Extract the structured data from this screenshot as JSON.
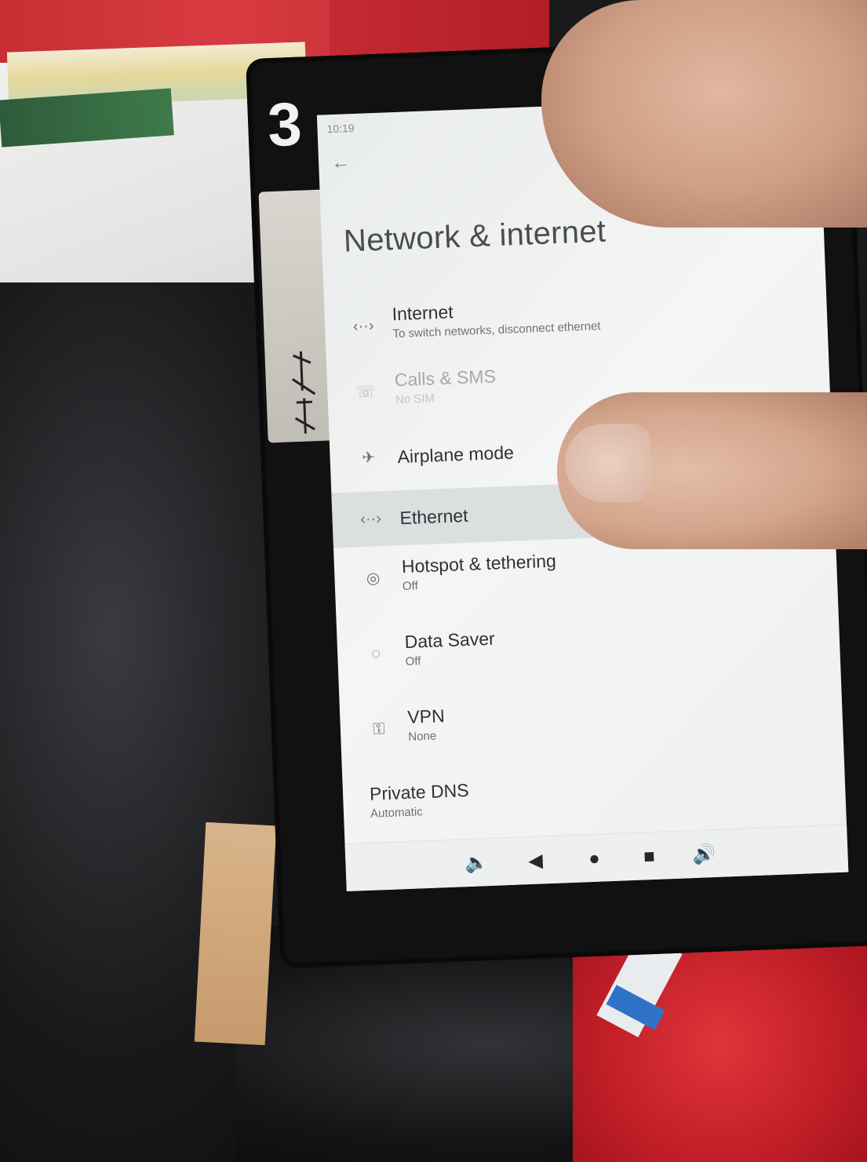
{
  "device": {
    "marker_text": "3",
    "tape_glyph": "handwritten-note"
  },
  "status_bar": {
    "time": "10:19"
  },
  "header": {
    "back_icon": "arrow-left-icon",
    "title": "Network & internet"
  },
  "settings_items": [
    {
      "icon": "ethernet-icon",
      "title": "Internet",
      "subtitle": "To switch networks, disconnect ethernet",
      "enabled": true
    },
    {
      "icon": "calls-sms-icon",
      "title": "Calls & SMS",
      "subtitle": "No SIM",
      "enabled": false
    },
    {
      "icon": "airplane-icon",
      "title": "Airplane mode",
      "subtitle": "",
      "enabled": true
    },
    {
      "icon": "ethernet-icon",
      "title": "Ethernet",
      "subtitle": "",
      "enabled": true
    },
    {
      "icon": "hotspot-icon",
      "title": "Hotspot & tethering",
      "subtitle": "Off",
      "enabled": true
    },
    {
      "icon": "data-saver-icon",
      "title": "Data Saver",
      "subtitle": "Off",
      "enabled": true
    },
    {
      "icon": "vpn-key-icon",
      "title": "VPN",
      "subtitle": "None",
      "enabled": true
    },
    {
      "icon": "",
      "title": "Private DNS",
      "subtitle": "Automatic",
      "enabled": true
    }
  ],
  "nav_bar": {
    "volume_down_icon": "volume-down-icon",
    "back_icon": "back-triangle-icon",
    "home_icon": "home-circle-icon",
    "recents_icon": "recents-square-icon",
    "volume_up_icon": "volume-up-icon"
  },
  "colors": {
    "screen_bg": "#f1f2f2",
    "title_text": "#4a4d50",
    "item_text": "#2f3235",
    "disabled_text": "#a6a9ab",
    "pressed_row": "#dcdfe0"
  }
}
